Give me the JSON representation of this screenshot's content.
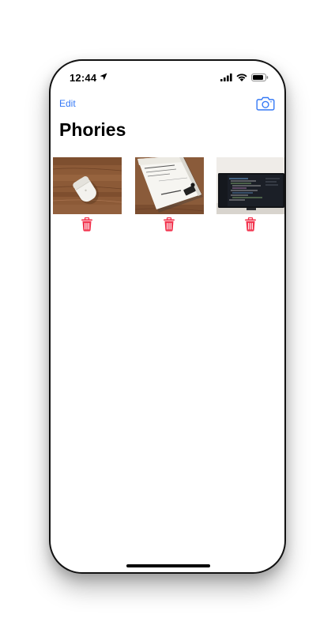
{
  "status_bar": {
    "time": "12:44",
    "location_icon": "location-arrow-icon",
    "signal_icon": "cellular-signal-icon",
    "wifi_icon": "wifi-icon",
    "battery_icon": "battery-icon"
  },
  "nav": {
    "edit_label": "Edit",
    "camera_icon": "camera-icon"
  },
  "page": {
    "title": "Phories"
  },
  "photos": [
    {
      "subject": "airpods-case-on-wood",
      "delete_icon": "trash-icon"
    },
    {
      "subject": "notebook-on-wood",
      "delete_icon": "trash-icon"
    },
    {
      "subject": "monitor-with-code",
      "delete_icon": "trash-icon"
    }
  ],
  "colors": {
    "accent": "#3478f6",
    "delete": "#f2354f",
    "background": "#ffffff"
  }
}
